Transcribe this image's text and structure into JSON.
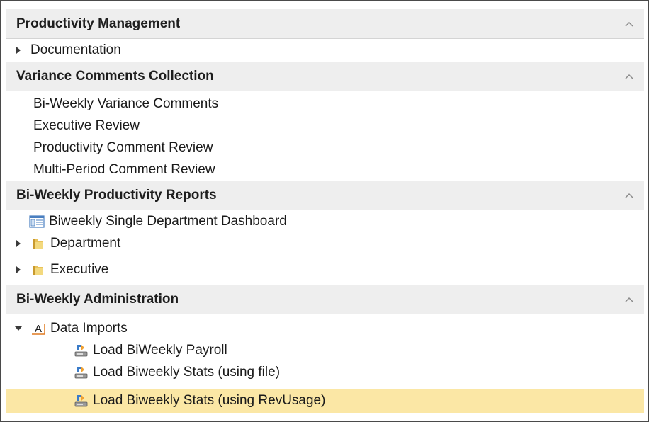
{
  "sections": [
    {
      "title": "Productivity Management",
      "collapse_icon": "chevron-up-icon"
    },
    {
      "title": "Variance Comments Collection",
      "collapse_icon": "chevron-up-icon"
    },
    {
      "title": "Bi-Weekly Productivity Reports",
      "collapse_icon": "chevron-up-icon"
    },
    {
      "title": "Bi-Weekly Administration",
      "collapse_icon": "chevron-up-icon"
    }
  ],
  "productivity_management": {
    "items": [
      {
        "label": "Documentation",
        "expand_icon": "triangle-right-icon"
      }
    ]
  },
  "variance_comments": {
    "items": [
      {
        "label": "Bi-Weekly Variance Comments"
      },
      {
        "label": "Executive Review"
      },
      {
        "label": "Productivity Comment Review"
      },
      {
        "label": "Multi-Period Comment Review"
      }
    ]
  },
  "productivity_reports": {
    "items": [
      {
        "label": "Biweekly Single Department Dashboard",
        "icon": "dashboard-icon"
      },
      {
        "label": "Department",
        "icon": "folder-icon",
        "expand_icon": "triangle-right-icon"
      },
      {
        "label": "Executive",
        "icon": "folder-icon",
        "expand_icon": "triangle-right-icon"
      }
    ]
  },
  "administration": {
    "group": {
      "label": "Data Imports",
      "icon": "data-imports-icon",
      "expand_icon": "triangle-down-icon"
    },
    "items": [
      {
        "label": "Load BiWeekly Payroll",
        "icon": "load-import-icon"
      },
      {
        "label": "Load Biweekly Stats (using file)",
        "icon": "load-import-icon"
      },
      {
        "label": "Load Biweekly Stats (using RevUsage)",
        "icon": "load-import-icon",
        "selected": true
      }
    ]
  },
  "colors": {
    "header_bg": "#eeeeee",
    "selected_bg": "#fbe7a5",
    "folder": "#e9c25a"
  }
}
